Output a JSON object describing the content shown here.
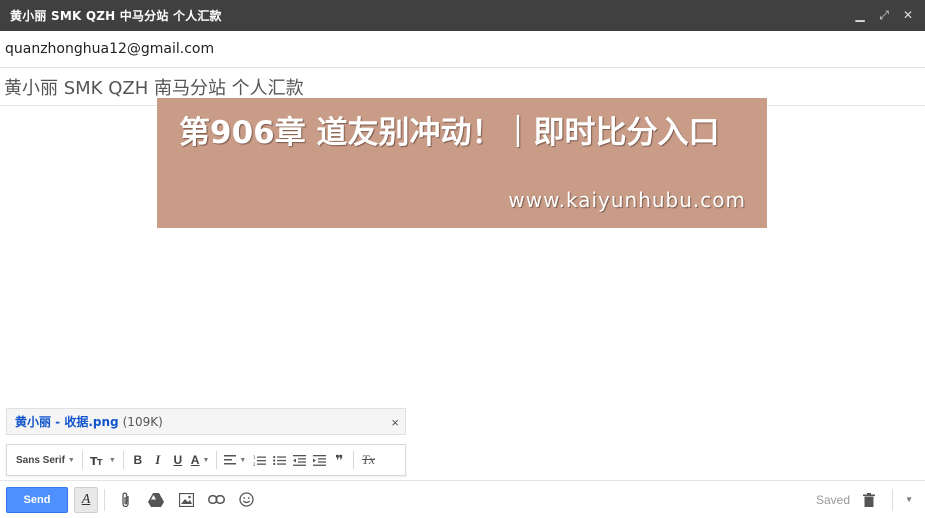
{
  "window": {
    "title": "黄小丽 SMK QZH   中马分站 个人汇款",
    "controls": {
      "minimize": "▁",
      "expand": "⤢",
      "close": "✕"
    }
  },
  "compose": {
    "to": "quanzhonghua12@gmail.com",
    "subject": "黄小丽  SMK QZH  南马分站  个人汇款"
  },
  "overlay": {
    "title": "第906章 道友别冲动！｜即时比分入口",
    "url": "www.kaiyunhubu.com"
  },
  "attachment": {
    "name": "黄小丽 - 收据.png",
    "size": "(109K)",
    "close": "×"
  },
  "formatting": {
    "font": "Sans Serif",
    "size_icon": "size-icon",
    "bold": "B",
    "italic": "I",
    "underline": "U",
    "text_color": "A",
    "remove_formatting": "Tx"
  },
  "footer": {
    "send_label": "Send",
    "format_toggle": "A",
    "saved_label": "Saved"
  },
  "colors": {
    "send_blue": "#4d90fe",
    "titlebar": "#404040",
    "overlay": "#c99c88",
    "link": "#1155cc"
  }
}
